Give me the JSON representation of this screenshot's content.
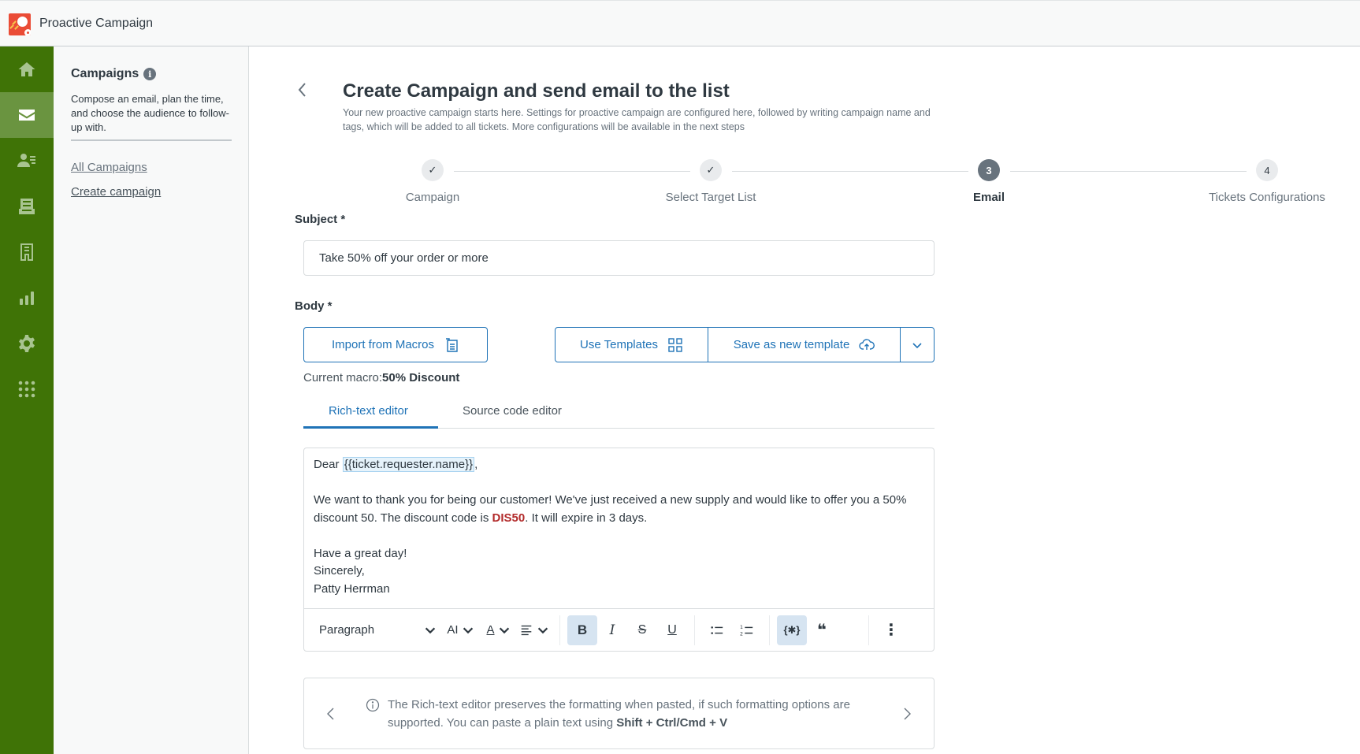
{
  "app": {
    "title": "Proactive Campaign",
    "brand_color": "#ea4c36",
    "rail_color": "#3f7306"
  },
  "rail": {
    "items": [
      {
        "icon": "home-icon",
        "label": "Home",
        "active": false
      },
      {
        "icon": "mail-icon",
        "label": "Campaigns",
        "active": true
      },
      {
        "icon": "contacts-icon",
        "label": "Contacts",
        "active": false
      },
      {
        "icon": "inbox-icon",
        "label": "Inbox",
        "active": false
      },
      {
        "icon": "receipt-icon",
        "label": "Templates",
        "active": false
      },
      {
        "icon": "bar-chart-icon",
        "label": "Reports",
        "active": false
      },
      {
        "icon": "gear-icon",
        "label": "Settings",
        "active": false
      },
      {
        "icon": "apps-grid-icon",
        "label": "Apps",
        "active": false
      }
    ]
  },
  "subnav": {
    "title": "Campaigns",
    "info_glyph": "i",
    "description": "Compose an email, plan the time, and choose the audience to follow-up with.",
    "links": [
      {
        "label": "All Campaigns",
        "current": false
      },
      {
        "label": "Create campaign",
        "current": true
      }
    ]
  },
  "page": {
    "title": "Create Campaign and send email to the list",
    "subtitle": "Your new proactive campaign starts here. Settings for proactive campaign are configured here, followed by writing campaign name and tags, which will be added to all tickets. More configurations will be available in the next steps"
  },
  "stepper": {
    "steps": [
      {
        "label": "Campaign",
        "state": "done",
        "marker": "✓"
      },
      {
        "label": "Select Target List",
        "state": "done",
        "marker": "✓"
      },
      {
        "label": "Email",
        "state": "current",
        "marker": "3"
      },
      {
        "label": "Tickets Configurations",
        "state": "upcoming",
        "marker": "4"
      }
    ]
  },
  "form": {
    "subject_label": "Subject *",
    "subject_value": "Take 50% off your order or more",
    "body_label": "Body *",
    "import_macros_label": "Import from Macros",
    "use_templates_label": "Use Templates",
    "save_template_label": "Save as new template",
    "current_macro_prefix": "Current macro:",
    "current_macro_name": "50% Discount"
  },
  "tabs": [
    {
      "label": "Rich-text editor",
      "active": true
    },
    {
      "label": "Source code editor",
      "active": false
    }
  ],
  "editor": {
    "greeting": "Dear ",
    "placeholder": "{{ticket.requester.name}}",
    "greeting_end": ",",
    "para1_a": "We want to thank you for being our customer! We've just received a new supply and would like to offer you a 50% discount 50. The discount code is ",
    "discount_code": "DIS50",
    "para1_b": ". It will expire in 3 days.",
    "line_closing1": "Have a great day!",
    "line_closing2": "Sincerely,",
    "line_signature": "Patty Herrman",
    "code_color": "#b22a2a"
  },
  "toolbar": {
    "block_format": "Paragraph",
    "font_size_glyph": "AI",
    "font_color_glyph": "A",
    "bold_glyph": "B",
    "italic_glyph": "I",
    "strike_glyph": "S",
    "underline_glyph": "U",
    "placeholder_glyph": "{✱}",
    "quote_glyph": "❝",
    "more_glyph": "⋮"
  },
  "notice": {
    "text": "The Rich-text editor preserves the formatting when pasted, if such formatting options are supported. You can paste a plain text using ",
    "shortcut": "Shift + Ctrl/Cmd + V"
  }
}
